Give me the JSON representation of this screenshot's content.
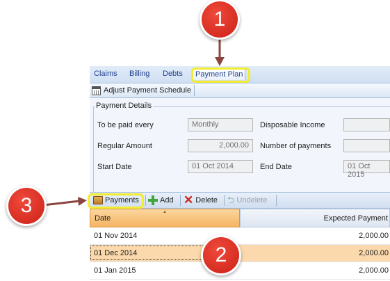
{
  "menu": {
    "tabs": [
      {
        "label": "Claims"
      },
      {
        "label": "Billing"
      },
      {
        "label": "Debts"
      },
      {
        "label": "Payment Plan"
      }
    ]
  },
  "toolbar": {
    "adjust_label": "Adjust Payment Schedule"
  },
  "payment_details": {
    "title": "Payment Details",
    "to_be_paid_label": "To be paid every",
    "to_be_paid_value": "Monthly",
    "regular_amount_label": "Regular Amount",
    "regular_amount_value": "2,000.00",
    "start_date_label": "Start Date",
    "start_date_value": "01 Oct 2014",
    "disposable_income_label": "Disposable Income",
    "disposable_income_value": "",
    "number_of_payments_label": "Number of payments",
    "number_of_payments_value": "",
    "end_date_label": "End Date",
    "end_date_value": "01 Oct 2015"
  },
  "grid_toolbar": {
    "payments_label": "Payments",
    "add_label": "Add",
    "delete_label": "Delete",
    "undelete_label": "Undelete"
  },
  "grid": {
    "columns": [
      "Date",
      "Expected Payment"
    ],
    "rows": [
      {
        "date": "01 Nov 2014",
        "amount": "2,000.00"
      },
      {
        "date": "01 Dec 2014",
        "amount": "2,000.00"
      },
      {
        "date": "01 Jan 2015",
        "amount": "2,000.00"
      }
    ]
  },
  "callouts": [
    {
      "number": "1"
    },
    {
      "number": "2"
    },
    {
      "number": "3"
    }
  ],
  "colors": {
    "highlight": "#f2ec2f",
    "callout_red": "#d82a1e",
    "arrow": "#8b4540",
    "selected_row": "#fbd9ac"
  }
}
